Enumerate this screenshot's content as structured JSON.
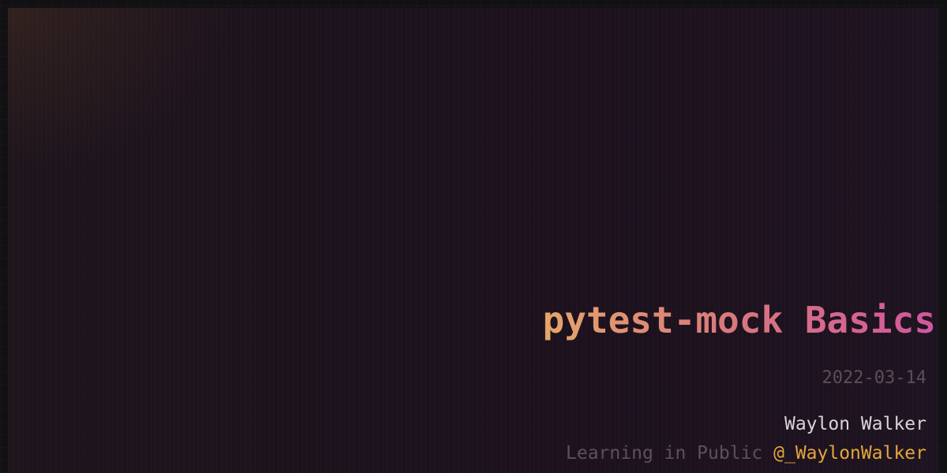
{
  "post": {
    "title": "pytest-mock Basics",
    "date": "2022-03-14",
    "author": "Waylon Walker",
    "tagline": "Learning in Public",
    "handle": "@_WaylonWalker"
  },
  "colors": {
    "title_gradient_start": "#e6a56a",
    "title_gradient_end": "#d0569e",
    "handle": "#e3a63d",
    "background": "#1c111d"
  }
}
